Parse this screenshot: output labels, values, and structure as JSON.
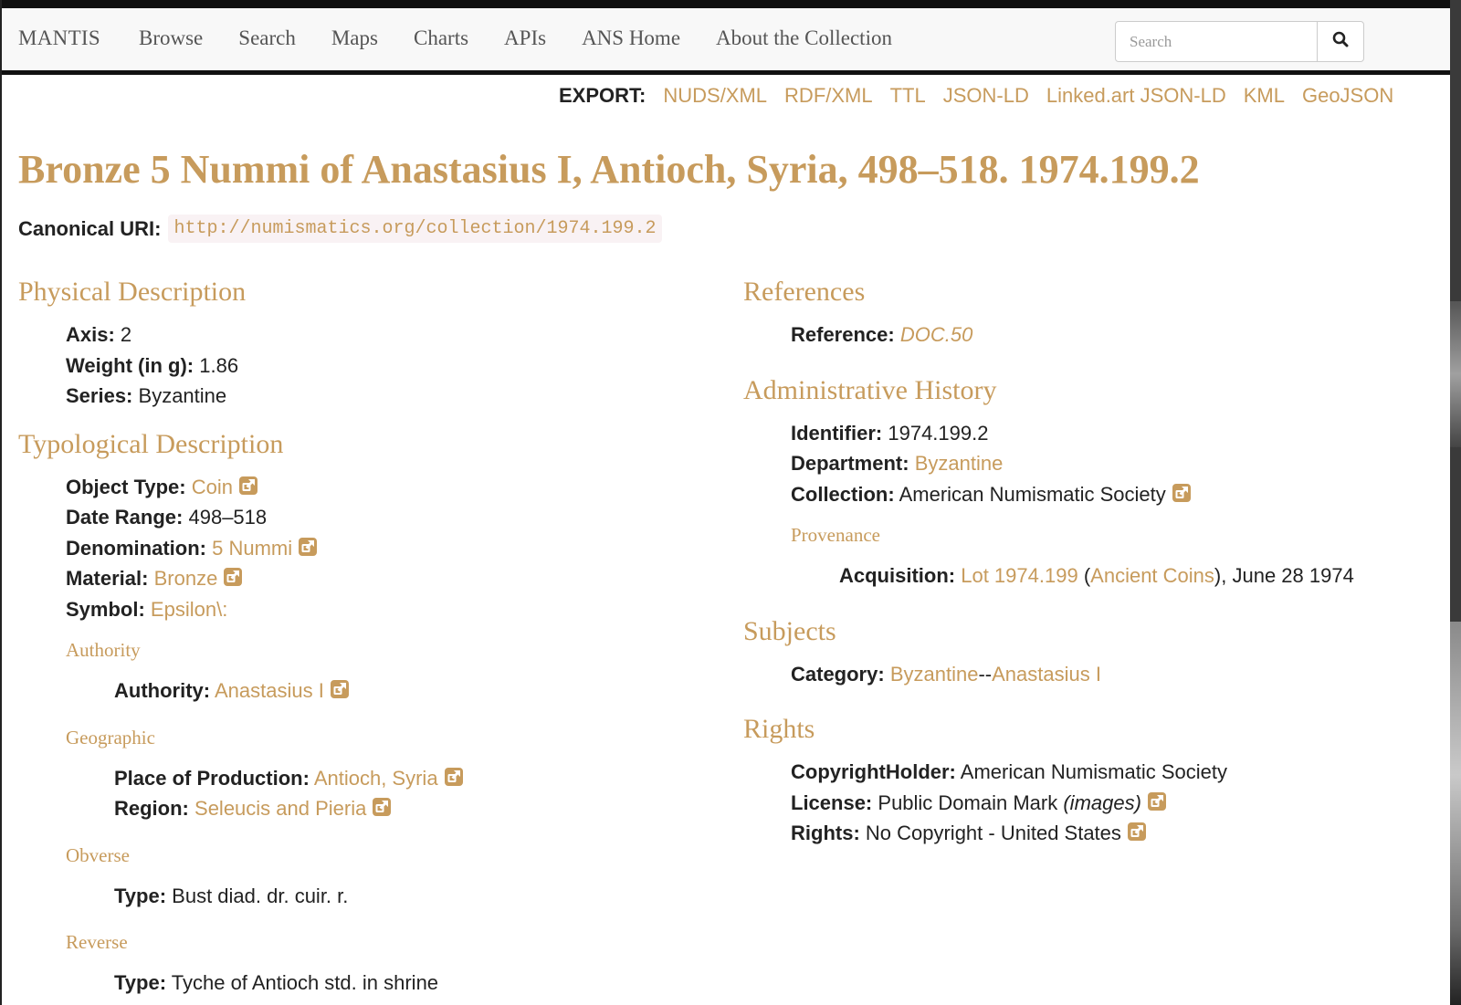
{
  "nav": {
    "brand": "MANTIS",
    "links": [
      "Browse",
      "Search",
      "Maps",
      "Charts",
      "APIs",
      "ANS Home",
      "About the Collection"
    ],
    "search_placeholder": "Search"
  },
  "export": {
    "label": "EXPORT:",
    "links": [
      "NUDS/XML",
      "RDF/XML",
      "TTL",
      "JSON-LD",
      "Linked.art JSON-LD",
      "KML",
      "GeoJSON"
    ]
  },
  "title": "Bronze 5 Nummi of Anastasius I, Antioch, Syria, 498–518. 1974.199.2",
  "canonical": {
    "label": "Canonical URI:",
    "uri": "http://numismatics.org/collection/1974.199.2"
  },
  "physical": {
    "heading": "Physical Description",
    "axis_label": "Axis:",
    "axis": "2",
    "weight_label": "Weight (in g):",
    "weight": "1.86",
    "series_label": "Series:",
    "series": "Byzantine"
  },
  "typological": {
    "heading": "Typological Description",
    "object_type_label": "Object Type:",
    "object_type": "Coin",
    "date_range_label": "Date Range:",
    "date_range": "498–518",
    "denomination_label": "Denomination:",
    "denomination": "5 Nummi",
    "material_label": "Material:",
    "material": "Bronze",
    "symbol_label": "Symbol:",
    "symbol": "Epsilon\\:",
    "authority_heading": "Authority",
    "authority_label": "Authority:",
    "authority": "Anastasius I",
    "geographic_heading": "Geographic",
    "place_label": "Place of Production:",
    "place": "Antioch, Syria",
    "region_label": "Region:",
    "region": "Seleucis and Pieria",
    "obverse_heading": "Obverse",
    "obverse_type_label": "Type:",
    "obverse_type": "Bust diad. dr. cuir. r.",
    "reverse_heading": "Reverse",
    "reverse_type_label": "Type:",
    "reverse_type": "Tyche of Antioch std. in shrine"
  },
  "references": {
    "heading": "References",
    "reference_label": "Reference:",
    "reference": "DOC.50"
  },
  "admin": {
    "heading": "Administrative History",
    "identifier_label": "Identifier:",
    "identifier": "1974.199.2",
    "department_label": "Department:",
    "department": "Byzantine",
    "collection_label": "Collection:",
    "collection": "American Numismatic Society",
    "provenance_heading": "Provenance",
    "acquisition_label": "Acquisition:",
    "acquisition_lot": "Lot 1974.199",
    "acquisition_source": "Ancient Coins",
    "acquisition_date": "June 28 1974"
  },
  "subjects": {
    "heading": "Subjects",
    "category_label": "Category:",
    "category_1": "Byzantine",
    "category_sep": "--",
    "category_2": "Anastasius I"
  },
  "rights": {
    "heading": "Rights",
    "holder_label": "CopyrightHolder:",
    "holder": "American Numismatic Society",
    "license_label": "License:",
    "license": "Public Domain Mark",
    "license_note": "(images)",
    "rights_label": "Rights:",
    "rights": "No Copyright - United States"
  },
  "colors": {
    "accent": "#c79b5c",
    "text": "#222222",
    "navbar_bg": "#f8f8f8"
  },
  "icons": {
    "external": "external-link-icon",
    "search": "search-icon"
  }
}
